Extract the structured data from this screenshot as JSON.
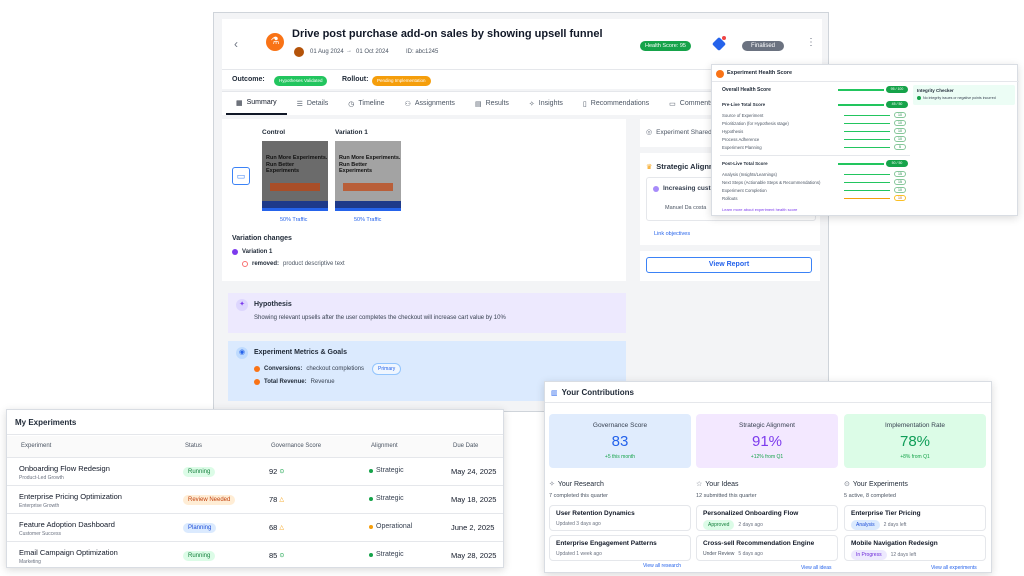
{
  "main": {
    "title": "Drive post purchase add-on sales by showing upsell funnel",
    "start_date": "01 Aug 2024",
    "end_date": "01 Oct 2024",
    "id_label": "ID: abc1245",
    "health_badge": "Health Score: 95",
    "status_badge": "Finalised",
    "outcome_label": "Outcome:",
    "outcome_value": "Hypotheses Validated",
    "rollout_label": "Rollout:",
    "rollout_value": "Pending Implementation",
    "tabs": [
      {
        "label": "Summary",
        "icon": "grid-icon"
      },
      {
        "label": "Details",
        "icon": "list-icon"
      },
      {
        "label": "Timeline",
        "icon": "clock-icon"
      },
      {
        "label": "Assignments",
        "icon": "user-icon"
      },
      {
        "label": "Results",
        "icon": "table-icon"
      },
      {
        "label": "Insights",
        "icon": "bulb-icon"
      },
      {
        "label": "Recommendations",
        "icon": "doc-icon"
      },
      {
        "label": "Comments",
        "icon": "comment-icon"
      }
    ],
    "control_label": "Control",
    "variation_label": "Variation 1",
    "traffic_control": "50% Traffic",
    "traffic_variation": "50% Traffic",
    "thumb_line1": "Run More Experiments.",
    "thumb_line2": "Run Better Experiments",
    "variation_changes_title": "Variation changes",
    "variation_changes_item": "Variation 1",
    "removed_label": "removed:",
    "removed_value": "product descriptive text",
    "experiment_shared": "Experiment Shared",
    "strategic_alignment": "Strategic Alignment",
    "increasing_customer": "Increasing customer",
    "manuel": "Manuel Da costa",
    "link_objectives": "Link objectives",
    "view_report": "View Report",
    "hypothesis_title": "Hypothesis",
    "hypothesis_text": "Showing relevant upsells after the user completes the checkout will increase cart value by 10%",
    "metrics_title": "Experiment Metrics & Goals",
    "conversions_label": "Conversions:",
    "conversions_value": "checkout completions",
    "primary_badge": "Primary",
    "revenue_label": "Total Revenue:",
    "revenue_value": "Revenue"
  },
  "health": {
    "title": "Experiment Health Score",
    "overall": "Overall Health Score",
    "overall_val": "95 / 100",
    "prelive_title": "Pre-Live Total Score",
    "prelive_val": "45 / 50",
    "prelive_items": [
      "Source of Experiment",
      "Prioritization (for Hypothesis stage)",
      "Hypothesis",
      "Process Adherence",
      "Experiment Planning"
    ],
    "prelive_vals": [
      "10",
      "10",
      "10",
      "10",
      "5"
    ],
    "postlive_title": "Post-Live Total Score",
    "postlive_val": "50 / 50",
    "postlive_items": [
      "Analysis (Insights/Learnings)",
      "Next Steps (Actionable Steps & Recommendations)",
      "Experiment Completion",
      "Rollouts"
    ],
    "postlive_vals": [
      "15",
      "15",
      "10",
      "10"
    ],
    "integrity_title": "Integrity Checker",
    "integrity_text": "No integrity issues or negative points incurred",
    "learn_more": "Learn more about experiment health score"
  },
  "my_experiments": {
    "title": "My Experiments",
    "headers": [
      "Experiment",
      "Status",
      "Governance Score",
      "Alignment",
      "Due Date"
    ],
    "rows": [
      {
        "name": "Onboarding Flow Redesign",
        "team": "Product-Led Growth",
        "status": "Running",
        "score": "92",
        "alignment": "Strategic",
        "due": "May 24, 2025"
      },
      {
        "name": "Enterprise Pricing Optimization",
        "team": "Enterprise Growth",
        "status": "Review Needed",
        "score": "78",
        "alignment": "Strategic",
        "due": "May 18, 2025"
      },
      {
        "name": "Feature Adoption Dashboard",
        "team": "Customer Success",
        "status": "Planning",
        "score": "68",
        "alignment": "Operational",
        "due": "June 2, 2025"
      },
      {
        "name": "Email Campaign Optimization",
        "team": "Marketing",
        "status": "Running",
        "score": "85",
        "alignment": "Strategic",
        "due": "May 28, 2025"
      }
    ]
  },
  "contributions": {
    "title": "Your Contributions",
    "kpis": [
      {
        "label": "Governance Score",
        "value": "83",
        "delta": "+5 this month",
        "color": "#2563eb"
      },
      {
        "label": "Strategic Alignment",
        "value": "91%",
        "delta": "+12% from Q1",
        "color": "#7c3aed"
      },
      {
        "label": "Implementation Rate",
        "value": "78%",
        "delta": "+8% from Q1",
        "color": "#0f9d58"
      }
    ],
    "research": {
      "title": "Your Research",
      "sub": "7 completed this quarter",
      "items": [
        {
          "title": "User Retention Dynamics",
          "sub": "Updated 3 days ago"
        },
        {
          "title": "Enterprise Engagement Patterns",
          "sub": "Updated 1 week ago"
        }
      ],
      "link": "View all research"
    },
    "ideas": {
      "title": "Your Ideas",
      "sub": "12 submitted this quarter",
      "items": [
        {
          "title": "Personalized Onboarding Flow",
          "tag": "Approved",
          "sub": "2 days ago"
        },
        {
          "title": "Cross-sell Recommendation Engine",
          "tag": "Under Review",
          "sub": "5 days ago"
        }
      ],
      "link": "View all ideas"
    },
    "experiments": {
      "title": "Your Experiments",
      "sub": "5 active, 8 completed",
      "items": [
        {
          "title": "Enterprise Tier Pricing",
          "tag": "Analysis",
          "sub": "2 days left"
        },
        {
          "title": "Mobile Navigation Redesign",
          "tag": "In Progress",
          "sub": "12 days left"
        }
      ],
      "link": "View all experiments"
    }
  }
}
